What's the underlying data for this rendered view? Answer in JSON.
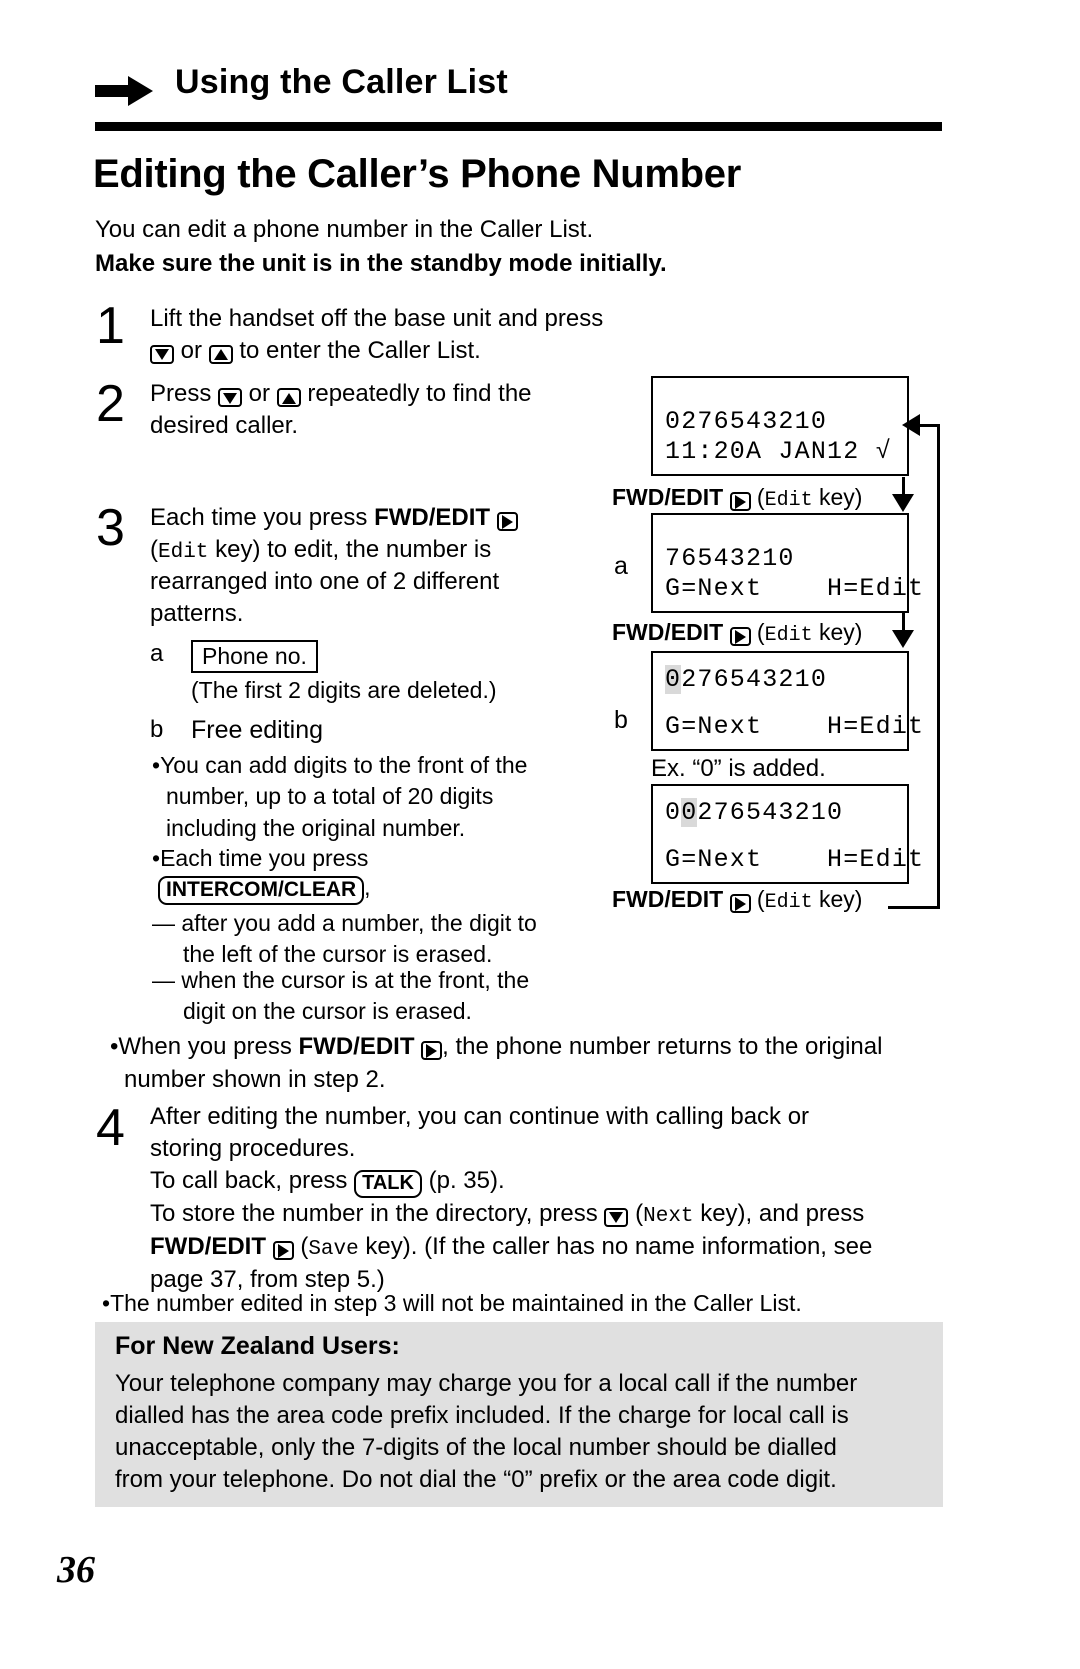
{
  "header": {
    "arrow_icon": "right-arrow-icon",
    "title": "Using the Caller List"
  },
  "main_title": "Editing the Caller’s Phone Number",
  "intro": {
    "line1": "You can edit a phone number in the Caller List.",
    "line2": "Make sure the unit is in the standby mode initially."
  },
  "steps": [
    {
      "number": "1",
      "line1_a": "Lift the handset off the base unit and press",
      "line2_a": " or ",
      "line2_b": " to enter the Caller List."
    },
    {
      "number": "2",
      "line1_a": "Press ",
      "line1_b": " or ",
      "line1_c": " repeatedly to find the",
      "line2": "desired caller."
    },
    {
      "number": "3",
      "line1_a": "Each time you press ",
      "line1_bold": "FWD/EDIT",
      "line2_a": "(",
      "line2_mono": "Edit",
      "line2_b": " key) to edit, the number is",
      "line3": "rearranged into one of 2 different",
      "line4": "patterns.",
      "sub_a_letter": "a",
      "sub_a_box": "Phone no.",
      "sub_a_note": "(The first 2 digits are deleted.)",
      "sub_b_letter": "b",
      "sub_b_title": "Free editing",
      "bullet1_line1": "You can add digits to the front of the",
      "bullet1_line2": "number, up to a total of 20 digits",
      "bullet1_line3": "including the original number.",
      "bullet2_line1": "Each time you press",
      "bullet2_key": "INTERCOM/CLEAR",
      "bullet2_comma": ",",
      "dash1_line1": "after you add a number, the digit to",
      "dash1_line2": "the left of the cursor is erased.",
      "dash2_line1": "when the cursor is at the front, the",
      "dash2_line2": "digit on the cursor is erased."
    },
    {
      "number": "4",
      "line1": "After editing the number, you can continue with calling back or",
      "line2": "storing procedures.",
      "line3_a": "To call back, press ",
      "line3_key": "TALK",
      "line3_b": " (p. 35).",
      "line4_a": "To store the number in the directory, press ",
      "line4_mono": "Next",
      "line4_b": " key), and press",
      "line5_bold": "FWD/EDIT",
      "line5_mono": "Save",
      "line5_b": " key). (If the caller has no name information, see",
      "line6": "page 37, from step 5.)"
    }
  ],
  "note_after_step3": {
    "part1": "When you press ",
    "bold": "FWD/EDIT",
    "part2": ", the phone number returns to the original",
    "line2": "number shown in step 2."
  },
  "note_after_step4": "The number edited in step 3 will not be maintained in the Caller List.",
  "gray_note": {
    "title": "For New Zealand Users:",
    "line1": "Your telephone company may charge you for a local call if the number",
    "line2": "dialled has the area code prefix included. If the charge for local call is",
    "line3": "unacceptable, only the 7-digits of the local number should be dialled",
    "line4": "from your telephone. Do not dial the “0” prefix or the area code digit."
  },
  "diagram": {
    "lcd1": {
      "line1": "0276543210",
      "line2": "11:20A JAN12 √"
    },
    "flow1": {
      "bold": "FWD/EDIT",
      "mono": "Edit",
      "tail": " key)"
    },
    "lcd2": {
      "letter": "a",
      "line1": "76543210",
      "line2_left": "G=Next",
      "line2_right": "H=Edit"
    },
    "flow2": {
      "bold": "FWD/EDIT",
      "mono": "Edit",
      "tail": " key)"
    },
    "lcd3": {
      "letter": "b",
      "line1_cursor": "0",
      "line1_rest": "276543210",
      "line2_left": "G=Next",
      "line2_right": "H=Edit"
    },
    "ex_label": "Ex. “0” is added.",
    "lcd4": {
      "line1_pre": "0",
      "line1_cursor": "0",
      "line1_rest": "276543210",
      "line2_left": "G=Next",
      "line2_right": "H=Edit"
    },
    "flow3": {
      "bold": "FWD/EDIT",
      "mono": "Edit",
      "tail": " key)"
    }
  },
  "page_number": "36"
}
